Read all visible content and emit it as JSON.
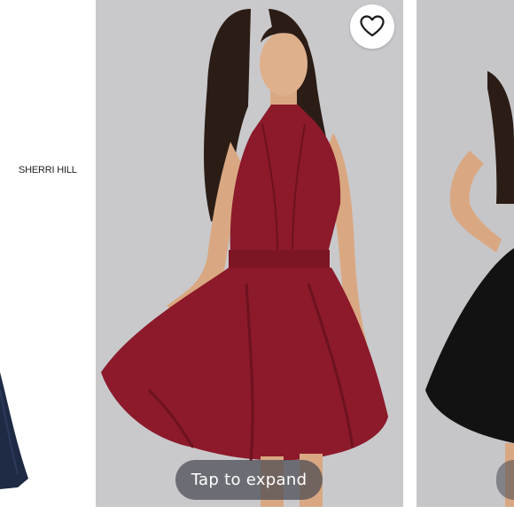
{
  "carousel": {
    "brand_label": "SHERRI HILL",
    "expand_label": "Tap to expand",
    "favorite_icon": "heart-outline-icon",
    "product_colors": {
      "left": "#1f2a44",
      "center": "#8c1a2a",
      "right": "#121212"
    }
  }
}
